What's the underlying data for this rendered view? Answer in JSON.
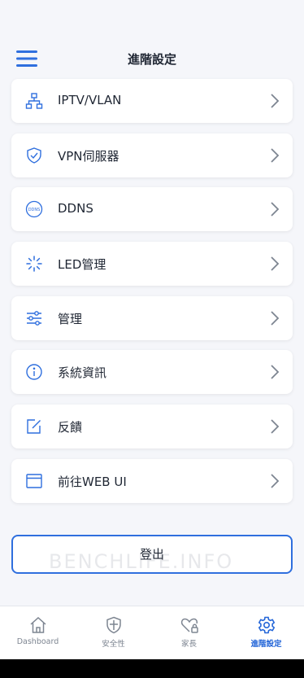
{
  "header": {
    "title": "進階設定",
    "menu_icon": "hamburger-menu-icon"
  },
  "accent_color": "#2f6fde",
  "items": [
    {
      "label": "IPTV/VLAN",
      "icon": "network-topology-icon"
    },
    {
      "label": "VPN伺服器",
      "icon": "shield-check-icon"
    },
    {
      "label": "DDNS",
      "icon": "ddns-icon",
      "icon_text": "DDNS"
    },
    {
      "label": "LED管理",
      "icon": "led-spinner-icon"
    },
    {
      "label": "管理",
      "icon": "sliders-icon"
    },
    {
      "label": "系統資訊",
      "icon": "info-icon"
    },
    {
      "label": "反饋",
      "icon": "edit-feedback-icon"
    },
    {
      "label": "前往WEB UI",
      "icon": "browser-window-icon"
    }
  ],
  "logout_label": "登出",
  "watermark": "BENCHLIFE.INFO",
  "tabs": [
    {
      "label": "Dashboard",
      "icon": "home-icon",
      "active": false
    },
    {
      "label": "安全性",
      "icon": "shield-icon",
      "active": false
    },
    {
      "label": "家長",
      "icon": "heart-lock-icon",
      "active": false
    },
    {
      "label": "進階設定",
      "icon": "gear-icon",
      "active": true
    }
  ]
}
